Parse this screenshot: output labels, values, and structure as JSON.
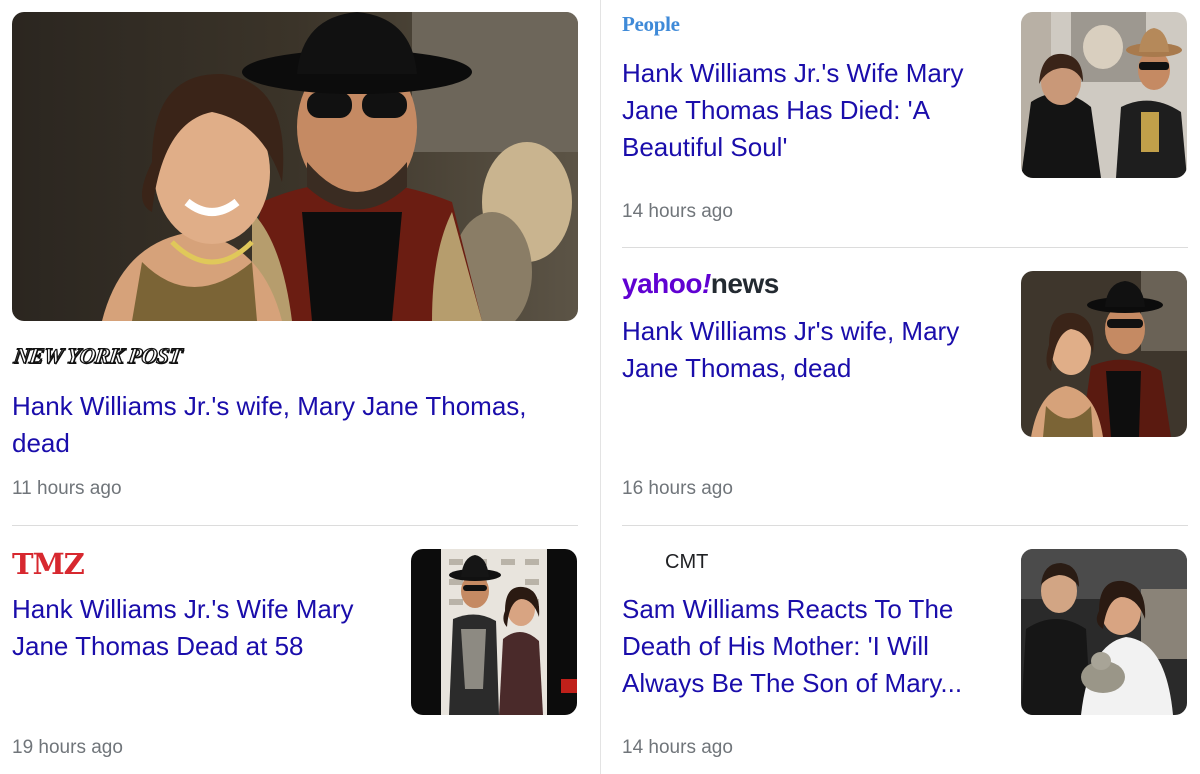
{
  "articles": [
    {
      "source": "NEW YORK POST",
      "headline": "Hank Williams Jr.'s wife, Mary Jane Thomas, dead",
      "time": "11 hours ago",
      "image_icon": "photo-couple-cowboy-hat"
    },
    {
      "source": "People",
      "headline": "Hank Williams Jr.'s Wife Mary Jane Thomas Has Died: 'A Beautiful Soul'",
      "time": "14 hours ago",
      "image_icon": "photo-couple-plaque"
    },
    {
      "source_part1": "yahoo",
      "source_mark": "!",
      "source_part2": "news",
      "headline": "Hank Williams Jr's wife, Mary Jane Thomas, dead",
      "time": "16 hours ago",
      "image_icon": "photo-couple-event"
    },
    {
      "source": "TMZ",
      "headline": "Hank Williams Jr.'s Wife Mary Jane Thomas Dead at 58",
      "time": "19 hours ago",
      "image_icon": "photo-red-carpet"
    },
    {
      "source": "CMT",
      "headline": "Sam Williams Reacts To The Death of His Mother: 'I Will Always Be The Son of Mary...",
      "time": "14 hours ago",
      "image_icon": "photo-mother-son"
    }
  ],
  "colors": {
    "headline": "#1a0dab",
    "time": "#70757a",
    "yahoo_purple": "#6001d2",
    "tmz_red": "#d7282f",
    "people_blue": "#3f8ad8"
  }
}
